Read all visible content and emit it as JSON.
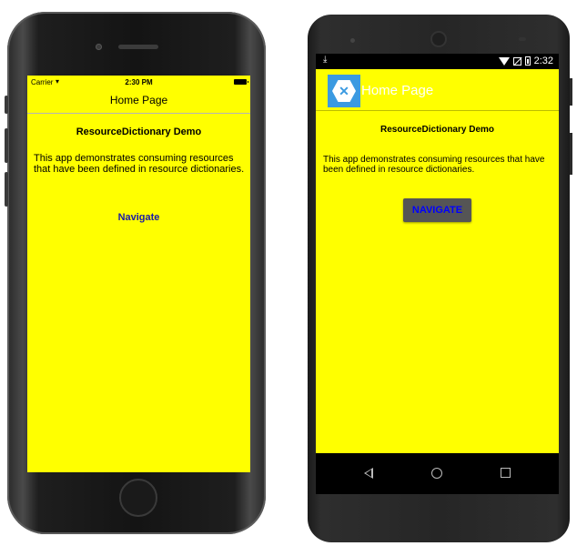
{
  "ios": {
    "status": {
      "carrier": "Carrier",
      "time": "2:30 PM"
    },
    "nav_title": "Home Page",
    "heading": "ResourceDictionary Demo",
    "body": "This app demonstrates consuming resources that have been defined in resource dictionaries.",
    "link_label": "Navigate"
  },
  "android": {
    "status": {
      "time": "2:32"
    },
    "toolbar_title": "Home Page",
    "heading": "ResourceDictionary Demo",
    "body": "This app demonstrates consuming resources that have been defined in resource dictionaries.",
    "button_label": "NAVIGATE"
  },
  "colors": {
    "page_background": "#ffff00",
    "ios_link": "#1a1aa6",
    "android_button_bg": "#555555",
    "android_button_text": "#0000ff",
    "android_logo": "#3b9ae1"
  }
}
